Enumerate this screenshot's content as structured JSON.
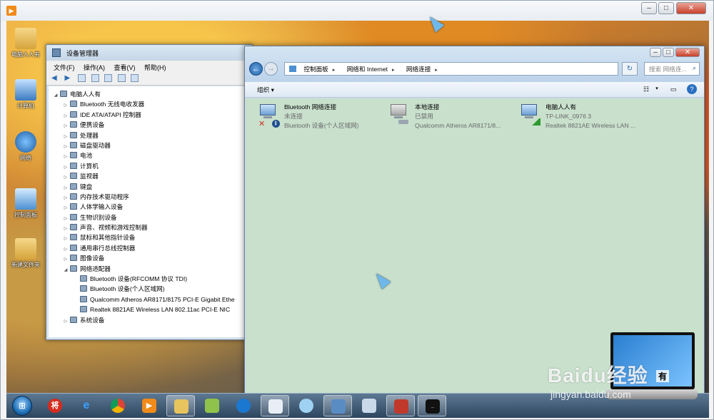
{
  "desktop": {
    "icons": [
      {
        "label": "电脑人人有"
      },
      {
        "label": "计算机"
      },
      {
        "label": "网络"
      },
      {
        "label": "控制面板"
      },
      {
        "label": "新建文件夹"
      }
    ]
  },
  "device_manager": {
    "title": "设备管理器",
    "menu": [
      "文件(F)",
      "操作(A)",
      "查看(V)",
      "帮助(H)"
    ],
    "tree": [
      {
        "label": "电脑人人有",
        "level": 0,
        "expand": "◢"
      },
      {
        "label": "Bluetooth 无线电收发器",
        "level": 1,
        "expand": "▷"
      },
      {
        "label": "IDE ATA/ATAPI 控制器",
        "level": 1,
        "expand": "▷"
      },
      {
        "label": "便携设备",
        "level": 1,
        "expand": "▷"
      },
      {
        "label": "处理器",
        "level": 1,
        "expand": "▷"
      },
      {
        "label": "磁盘驱动器",
        "level": 1,
        "expand": "▷"
      },
      {
        "label": "电池",
        "level": 1,
        "expand": "▷"
      },
      {
        "label": "计算机",
        "level": 1,
        "expand": "▷"
      },
      {
        "label": "监视器",
        "level": 1,
        "expand": "▷"
      },
      {
        "label": "键盘",
        "level": 1,
        "expand": "▷"
      },
      {
        "label": "内存技术驱动程序",
        "level": 1,
        "expand": "▷"
      },
      {
        "label": "人体学输入设备",
        "level": 1,
        "expand": "▷"
      },
      {
        "label": "生物识别设备",
        "level": 1,
        "expand": "▷"
      },
      {
        "label": "声音、视频和游戏控制器",
        "level": 1,
        "expand": "▷"
      },
      {
        "label": "鼠标和其他指针设备",
        "level": 1,
        "expand": "▷"
      },
      {
        "label": "通用串行总线控制器",
        "level": 1,
        "expand": "▷"
      },
      {
        "label": "图像设备",
        "level": 1,
        "expand": "▷"
      },
      {
        "label": "网络适配器",
        "level": 1,
        "expand": "◢"
      },
      {
        "label": "Bluetooth 设备(RFCOMM 协议 TDI)",
        "level": 2,
        "expand": ""
      },
      {
        "label": "Bluetooth 设备(个人区域网)",
        "level": 2,
        "expand": ""
      },
      {
        "label": "Qualcomm Atheros AR8171/8175 PCI-E Gigabit Ethe",
        "level": 2,
        "expand": ""
      },
      {
        "label": "Realtek 8821AE Wireless LAN 802.11ac PCI-E NIC",
        "level": 2,
        "expand": ""
      },
      {
        "label": "系统设备",
        "level": 1,
        "expand": "▷"
      }
    ]
  },
  "network_window": {
    "address_segments": [
      "控制面板",
      "网络和 Internet",
      "网络连接"
    ],
    "search_placeholder": "搜索 网络连...",
    "organize_label": "组织 ▾",
    "connections": [
      {
        "name": "Bluetooth 网络连接",
        "status": "未连接",
        "device": "Bluetooth 设备(个人区域网)",
        "badge": "✕",
        "badge_color": "#d0321f"
      },
      {
        "name": "本地连接",
        "status": "已禁用",
        "device": "Qualcomm Atheros AR8171/8...",
        "badge": "",
        "badge_color": "#666666"
      },
      {
        "name": "电脑人人有",
        "status": "TP-LINK_0976  3",
        "device": "Realtek 8821AE Wireless LAN ...",
        "badge": "",
        "badge_color": "#2f9a2f"
      }
    ]
  },
  "taskbar": {
    "items": [
      "start",
      "jiang",
      "ie",
      "chrome",
      "player",
      "explorer",
      "folder",
      "edge-like",
      "notepad",
      "pinwheel",
      "monitor",
      "paint",
      "toolbox",
      "cmd"
    ]
  },
  "watermark": {
    "brand": "Baidu经验",
    "url": "jingyan.baidu.com",
    "laptop_text": "有"
  }
}
